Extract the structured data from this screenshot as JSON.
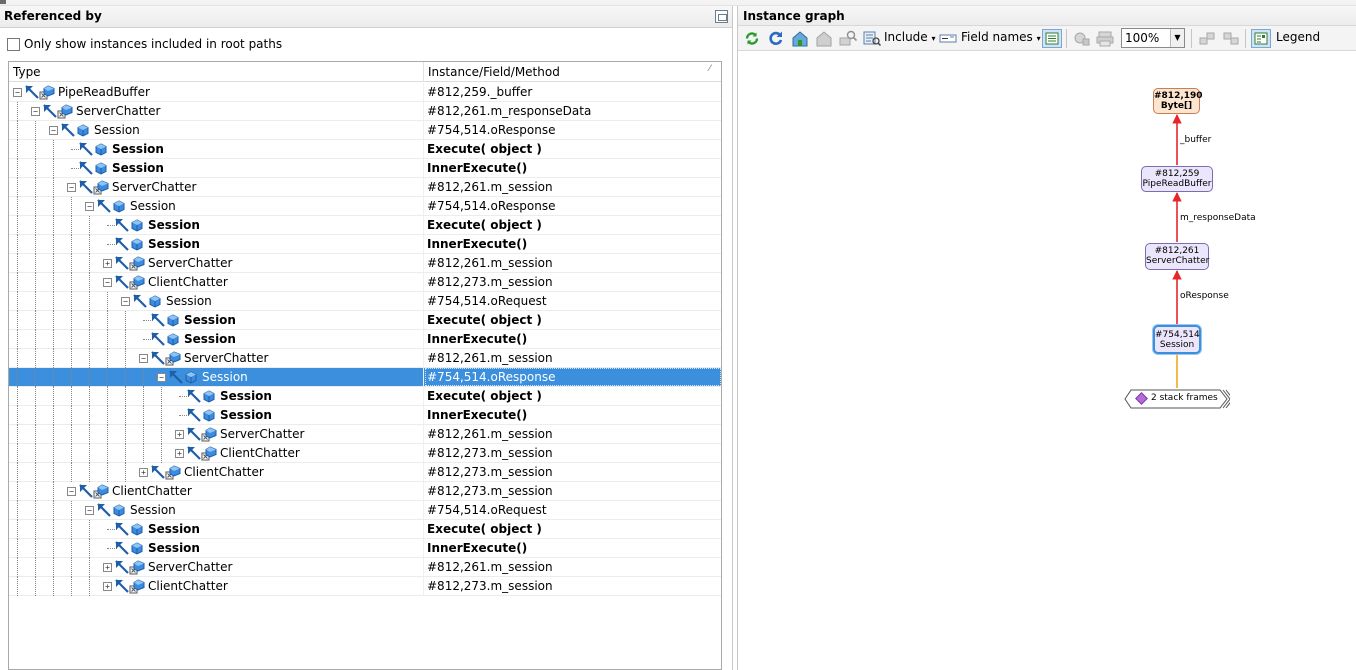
{
  "left": {
    "title": "Referenced by",
    "checkbox_label": "Only show instances included in root paths",
    "col_type": "Type",
    "col_instance": "Instance/Field/Method",
    "sort_mark": "⁄",
    "rows": [
      {
        "label": "PipeReadBuffer",
        "instance": "#812,259._buffer"
      },
      {
        "label": "ServerChatter",
        "instance": "#812,261.m_responseData"
      },
      {
        "label": "Session",
        "instance": "#754,514.oResponse"
      },
      {
        "label": "Session",
        "instance": "Execute( object )"
      },
      {
        "label": "Session",
        "instance": "InnerExecute()"
      },
      {
        "label": "ServerChatter",
        "instance": "#812,261.m_session"
      },
      {
        "label": "Session",
        "instance": "#754,514.oResponse"
      },
      {
        "label": "Session",
        "instance": "Execute( object )"
      },
      {
        "label": "Session",
        "instance": "InnerExecute()"
      },
      {
        "label": "ServerChatter",
        "instance": "#812,261.m_session"
      },
      {
        "label": "ClientChatter",
        "instance": "#812,273.m_session"
      },
      {
        "label": "Session",
        "instance": "#754,514.oRequest"
      },
      {
        "label": "Session",
        "instance": "Execute( object )"
      },
      {
        "label": "Session",
        "instance": "InnerExecute()"
      },
      {
        "label": "ServerChatter",
        "instance": "#812,261.m_session"
      },
      {
        "label": "Session",
        "instance": "#754,514.oResponse"
      },
      {
        "label": "Session",
        "instance": "Execute( object )"
      },
      {
        "label": "Session",
        "instance": "InnerExecute()"
      },
      {
        "label": "ServerChatter",
        "instance": "#812,261.m_session"
      },
      {
        "label": "ClientChatter",
        "instance": "#812,273.m_session"
      },
      {
        "label": "ClientChatter",
        "instance": "#812,273.m_session"
      },
      {
        "label": "ClientChatter",
        "instance": "#812,273.m_session"
      },
      {
        "label": "Session",
        "instance": "#754,514.oRequest"
      },
      {
        "label": "Session",
        "instance": "Execute( object )"
      },
      {
        "label": "Session",
        "instance": "InnerExecute()"
      },
      {
        "label": "ServerChatter",
        "instance": "#812,261.m_session"
      },
      {
        "label": "ClientChatter",
        "instance": "#812,273.m_session"
      }
    ]
  },
  "right": {
    "title": "Instance graph",
    "toolbar": {
      "include_label": "Include",
      "field_names_label": "Field names",
      "zoom_value": "100%",
      "legend_label": "Legend"
    },
    "nodes": {
      "byte_id": "#812,190",
      "byte_type": "Byte[]",
      "pipe_id": "#812,259",
      "pipe_type": "PipeReadBuffer",
      "server_id": "#812,261",
      "server_type": "ServerChatter",
      "session_id": "#754,514",
      "session_type": "Session",
      "stack_label": "2 stack frames"
    },
    "edges": {
      "buffer": "_buffer",
      "response_data": "m_responseData",
      "oresponse": "oResponse"
    },
    "colors": {
      "reference_edge": "#e8262a",
      "root_edge": "#f3b13a",
      "selection": "#3b8fdd"
    }
  }
}
